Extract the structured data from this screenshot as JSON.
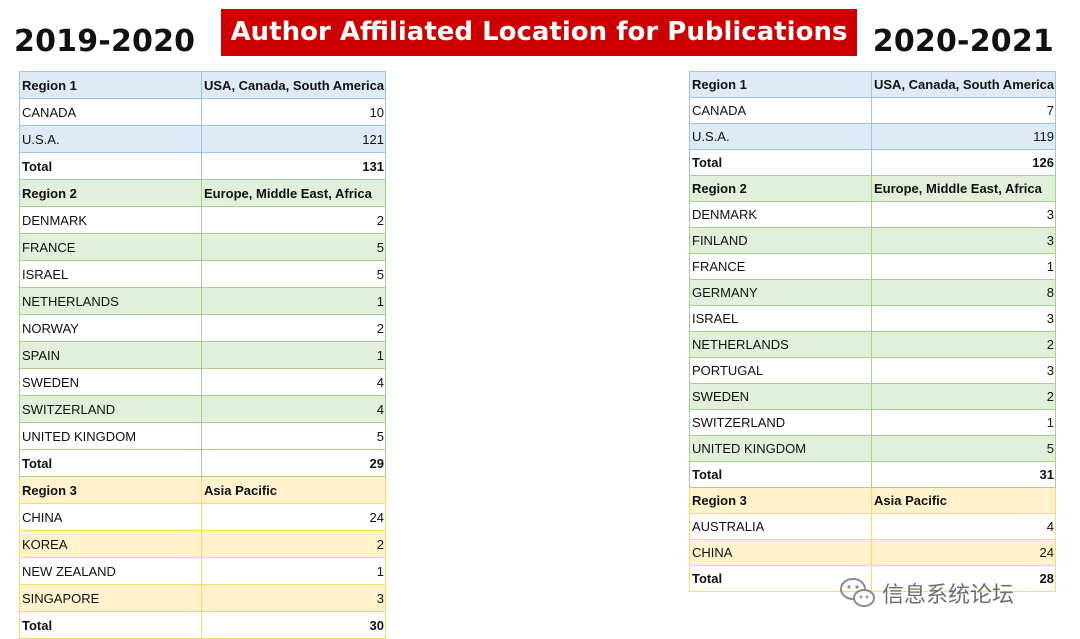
{
  "title": "Author Affiliated Location for Publications",
  "left": {
    "year": "2019-2020",
    "rows": [
      {
        "c1": "Region 1",
        "c2": "USA, Canada, South America",
        "kind": "hdr",
        "color": "b"
      },
      {
        "c1": "CANADA",
        "c2": "10",
        "kind": "row",
        "color": "b"
      },
      {
        "c1": "U.S.A.",
        "c2": "121",
        "kind": "row",
        "color": "b"
      },
      {
        "c1": "Total",
        "c2": "131",
        "kind": "tot",
        "color": "b"
      },
      {
        "c1": "Region 2",
        "c2": "Europe, Middle East, Africa",
        "kind": "hdr",
        "color": "g"
      },
      {
        "c1": "DENMARK",
        "c2": "2",
        "kind": "row",
        "color": "g"
      },
      {
        "c1": "FRANCE",
        "c2": "5",
        "kind": "row",
        "color": "g"
      },
      {
        "c1": "ISRAEL",
        "c2": "5",
        "kind": "row",
        "color": "g"
      },
      {
        "c1": "NETHERLANDS",
        "c2": "1",
        "kind": "row",
        "color": "g"
      },
      {
        "c1": "NORWAY",
        "c2": "2",
        "kind": "row",
        "color": "g"
      },
      {
        "c1": "SPAIN",
        "c2": "1",
        "kind": "row",
        "color": "g"
      },
      {
        "c1": "SWEDEN",
        "c2": "4",
        "kind": "row",
        "color": "g"
      },
      {
        "c1": "SWITZERLAND",
        "c2": "4",
        "kind": "row",
        "color": "g"
      },
      {
        "c1": "UNITED KINGDOM",
        "c2": "5",
        "kind": "row",
        "color": "g"
      },
      {
        "c1": "Total",
        "c2": "29",
        "kind": "tot",
        "color": "g"
      },
      {
        "c1": "Region 3",
        "c2": "Asia Pacific",
        "kind": "hdr",
        "color": "y"
      },
      {
        "c1": "CHINA",
        "c2": "24",
        "kind": "row",
        "color": "y"
      },
      {
        "c1": "KOREA",
        "c2": "2",
        "kind": "row",
        "color": "y"
      },
      {
        "c1": "NEW ZEALAND",
        "c2": "1",
        "kind": "row",
        "color": "y"
      },
      {
        "c1": "SINGAPORE",
        "c2": "3",
        "kind": "row",
        "color": "y"
      },
      {
        "c1": "Total",
        "c2": "30",
        "kind": "tot",
        "color": "y"
      }
    ]
  },
  "right": {
    "year": "2020-2021",
    "rows": [
      {
        "c1": "Region 1",
        "c2": "USA, Canada, South America",
        "kind": "hdr",
        "color": "b"
      },
      {
        "c1": "CANADA",
        "c2": "7",
        "kind": "row",
        "color": "b"
      },
      {
        "c1": "U.S.A.",
        "c2": "119",
        "kind": "row",
        "color": "b"
      },
      {
        "c1": "Total",
        "c2": "126",
        "kind": "tot",
        "color": "b"
      },
      {
        "c1": "Region 2",
        "c2": "Europe, Middle East, Africa",
        "kind": "hdr",
        "color": "g"
      },
      {
        "c1": "DENMARK",
        "c2": "3",
        "kind": "row",
        "color": "g"
      },
      {
        "c1": "FINLAND",
        "c2": "3",
        "kind": "row",
        "color": "g"
      },
      {
        "c1": "FRANCE",
        "c2": "1",
        "kind": "row",
        "color": "g"
      },
      {
        "c1": "GERMANY",
        "c2": "8",
        "kind": "row",
        "color": "g"
      },
      {
        "c1": "ISRAEL",
        "c2": "3",
        "kind": "row",
        "color": "g"
      },
      {
        "c1": "NETHERLANDS",
        "c2": "2",
        "kind": "row",
        "color": "g"
      },
      {
        "c1": "PORTUGAL",
        "c2": "3",
        "kind": "row",
        "color": "g"
      },
      {
        "c1": "SWEDEN",
        "c2": "2",
        "kind": "row",
        "color": "g"
      },
      {
        "c1": "SWITZERLAND",
        "c2": "1",
        "kind": "row",
        "color": "g"
      },
      {
        "c1": "UNITED KINGDOM",
        "c2": "5",
        "kind": "row",
        "color": "g"
      },
      {
        "c1": "Total",
        "c2": "31",
        "kind": "tot",
        "color": "g"
      },
      {
        "c1": "Region 3",
        "c2": "Asia Pacific",
        "kind": "hdr",
        "color": "y"
      },
      {
        "c1": "AUSTRALIA",
        "c2": "4",
        "kind": "row",
        "color": "y"
      },
      {
        "c1": "CHINA",
        "c2": "24",
        "kind": "row",
        "color": "y"
      },
      {
        "c1": "Total",
        "c2": "28",
        "kind": "tot",
        "color": "y"
      }
    ]
  },
  "watermark": {
    "text": "信息系统论坛",
    "icon": "wechat-icon"
  },
  "colors": {
    "banner": "#cc0000",
    "region1_fill": "#deeaf6",
    "region1_border": "#9dc3e6",
    "region2_fill": "#e2efda",
    "region2_border": "#a9d18e",
    "region3_fill": "#fff2cc",
    "region3_border": "#ffd966"
  }
}
